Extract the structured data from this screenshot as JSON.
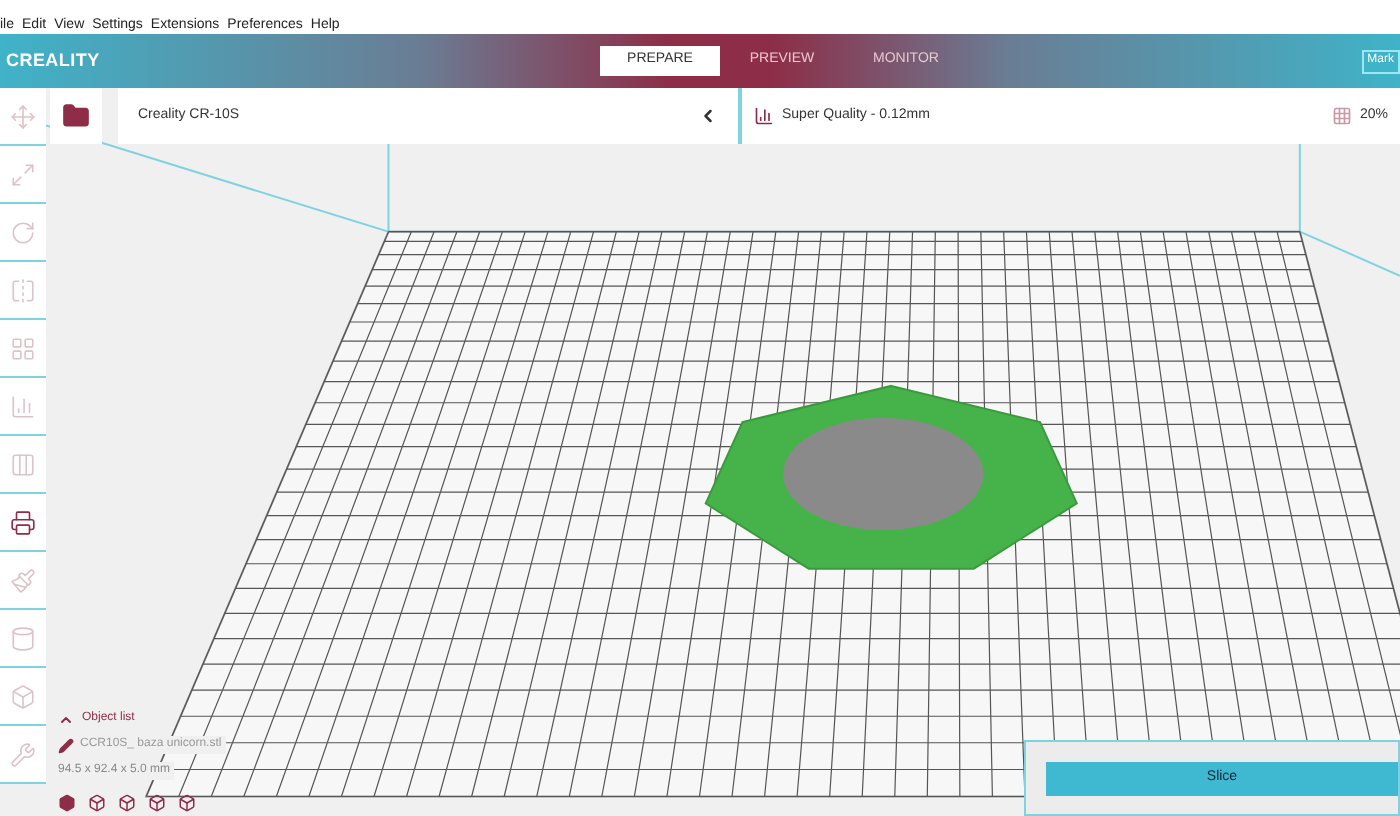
{
  "menu": [
    "ile",
    "Edit",
    "View",
    "Settings",
    "Extensions",
    "Preferences",
    "Help"
  ],
  "header": {
    "logo": "CREALITY",
    "tabs": [
      {
        "label": "PREPARE",
        "selected": true
      },
      {
        "label": "PREVIEW",
        "selected": false
      },
      {
        "label": "MONITOR",
        "selected": false
      }
    ],
    "account_button": "Mark"
  },
  "toolbar": {
    "printer": "Creality CR-10S",
    "profile": "Super Quality - 0.12mm",
    "infill": "20%"
  },
  "tools": [
    {
      "kind": "move",
      "selected": false
    },
    {
      "kind": "scale",
      "selected": false
    },
    {
      "kind": "rotate",
      "selected": false
    },
    {
      "kind": "mirror",
      "selected": false
    },
    {
      "kind": "arrange",
      "selected": false
    },
    {
      "kind": "steps",
      "selected": false
    },
    {
      "kind": "layers",
      "selected": false
    },
    {
      "kind": "support",
      "selected": true
    },
    {
      "kind": "paint",
      "selected": false
    },
    {
      "kind": "cylinder",
      "selected": false
    },
    {
      "kind": "box",
      "selected": false
    },
    {
      "kind": "wrench",
      "selected": false
    }
  ],
  "object_list": {
    "title": "Object list",
    "expanded": true,
    "file_name": "CCR10S_ baza unicorn.stl",
    "dimensions": "94.5 x 92.4 x 5.0 mm"
  },
  "slice_button": "Slice"
}
